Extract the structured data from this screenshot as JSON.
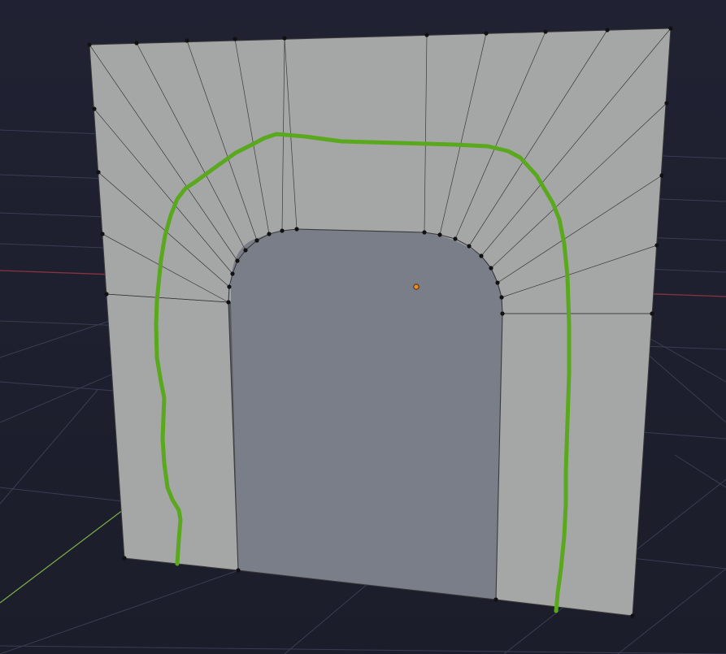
{
  "viewport": {
    "title": "",
    "background_top": "#202233",
    "background_bottom": "#1b1d2a"
  },
  "colors": {
    "grid_line": "#3a3d52",
    "x_axis": "#8a3340",
    "y_axis": "#7fb04a",
    "wall_face": "#a5a7a6",
    "inner_face": "#7a7e88",
    "jamb_face": "#5a5c62",
    "edge": "#3a3a3a",
    "vertex": "#111111",
    "annotation_stroke": "#5aa81e",
    "origin_point": "#f08a1e"
  },
  "icons": {
    "origin": "origin-point-icon"
  }
}
